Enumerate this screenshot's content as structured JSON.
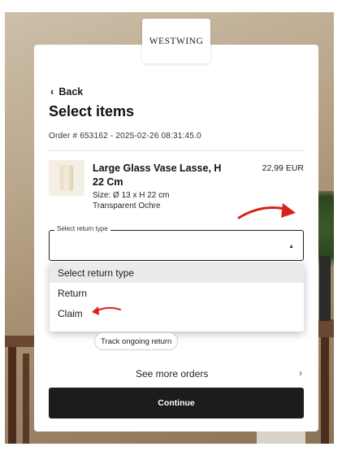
{
  "brand": {
    "logo": "WESTWING"
  },
  "nav": {
    "back_label": "Back"
  },
  "page": {
    "title": "Select items",
    "order_line": "Order # 653162 - 2025-02-26 08:31:45.0"
  },
  "item": {
    "name": "Large Glass Vase Lasse, H 22 Cm",
    "size": "Size: Ø 13 x H 22 cm",
    "color": "Transparent Ochre",
    "price": "22,99 EUR"
  },
  "return_select": {
    "legend": "Select return type",
    "value": "",
    "options": [
      "Select return type",
      "Return",
      "Claim"
    ],
    "highlighted_index": 0
  },
  "actions": {
    "track_label": "Track ongoing return",
    "more_orders_label": "See more orders",
    "continue_label": "Continue"
  },
  "colors": {
    "accent": "#1c1c1c",
    "annotation_arrow": "#d9221c"
  },
  "icons": {
    "back": "chevron-left-icon",
    "caret": "caret-down-icon",
    "more": "chevron-right-icon"
  }
}
